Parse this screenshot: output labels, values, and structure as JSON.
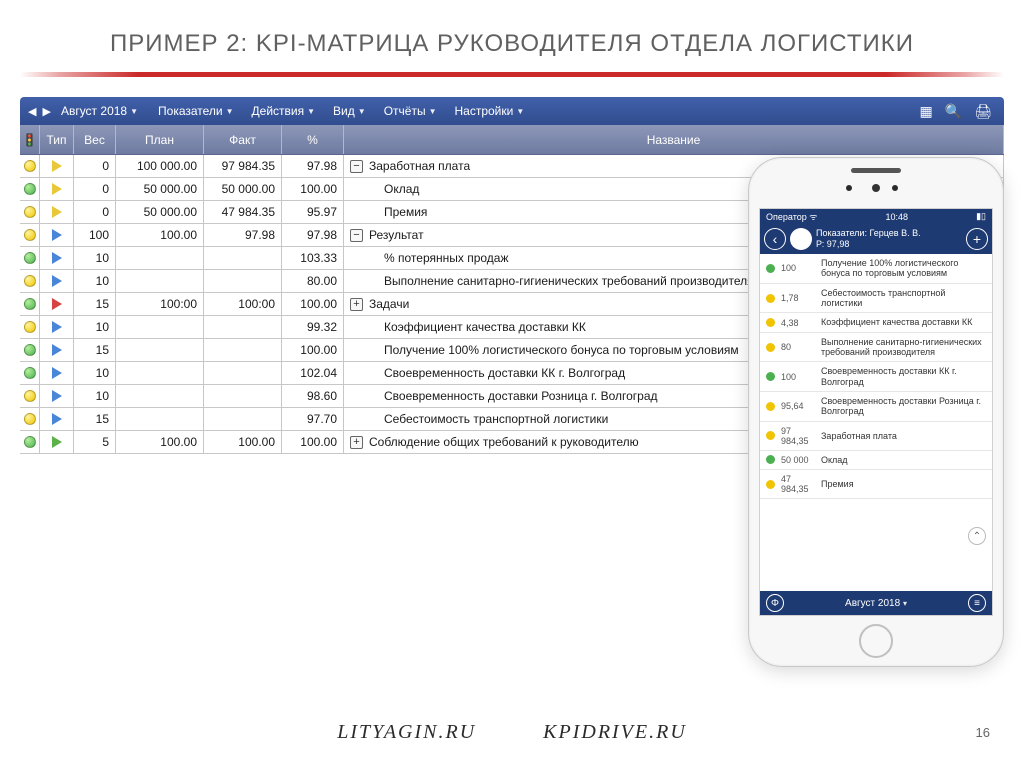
{
  "slide_title": "ПРИМЕР 2:  KPI-МАТРИЦА РУКОВОДИТЕЛЯ ОТДЕЛА ЛОГИСТИКИ",
  "toolbar": {
    "date": "Август 2018",
    "menus": [
      "Показатели",
      "Действия",
      "Вид",
      "Отчёты",
      "Настройки"
    ]
  },
  "columns": {
    "type": "Тип",
    "ves": "Вес",
    "plan": "План",
    "fact": "Факт",
    "pct": "%",
    "name": "Название"
  },
  "rows": [
    {
      "light": "yellow",
      "tri": "yellow",
      "ves": "0",
      "plan": "100 000.00",
      "fact": "97 984.35",
      "pct": "97.98",
      "name": "Заработная плата",
      "exp": "minus",
      "indent": 0
    },
    {
      "light": "green",
      "tri": "yellow",
      "ves": "0",
      "plan": "50 000.00",
      "fact": "50 000.00",
      "pct": "100.00",
      "name": "Оклад",
      "indent": 1
    },
    {
      "light": "yellow",
      "tri": "yellow",
      "ves": "0",
      "plan": "50 000.00",
      "fact": "47 984.35",
      "pct": "95.97",
      "name": "Премия",
      "indent": 1
    },
    {
      "light": "yellow",
      "tri": "blue",
      "ves": "100",
      "plan": "100.00",
      "fact": "97.98",
      "pct": "97.98",
      "name": "Результат",
      "exp": "minus",
      "indent": 0
    },
    {
      "light": "green",
      "tri": "blue",
      "ves": "10",
      "plan": "",
      "fact": "",
      "pct": "103.33",
      "name": "% потерянных продаж",
      "indent": 1
    },
    {
      "light": "yellow",
      "tri": "blue",
      "ves": "10",
      "plan": "",
      "fact": "",
      "pct": "80.00",
      "name": "Выполнение санитарно-гигиенических требований производителя",
      "indent": 1
    },
    {
      "light": "green",
      "tri": "red",
      "ves": "15",
      "plan": "100:00",
      "fact": "100:00",
      "pct": "100.00",
      "name": "Задачи",
      "exp": "plus",
      "indent": 0
    },
    {
      "light": "yellow",
      "tri": "blue",
      "ves": "10",
      "plan": "",
      "fact": "",
      "pct": "99.32",
      "name": "Коэффициент качества доставки КК",
      "indent": 1
    },
    {
      "light": "green",
      "tri": "blue",
      "ves": "15",
      "plan": "",
      "fact": "",
      "pct": "100.00",
      "name": "Получение 100% логистического бонуса по торговым условиям",
      "indent": 1
    },
    {
      "light": "green",
      "tri": "blue",
      "ves": "10",
      "plan": "",
      "fact": "",
      "pct": "102.04",
      "name": "Своевременность доставки КК г. Волгоград",
      "indent": 1
    },
    {
      "light": "yellow",
      "tri": "blue",
      "ves": "10",
      "plan": "",
      "fact": "",
      "pct": "98.60",
      "name": "Своевременность доставки Розница г. Волгоград",
      "indent": 1
    },
    {
      "light": "yellow",
      "tri": "blue",
      "ves": "15",
      "plan": "",
      "fact": "",
      "pct": "97.70",
      "name": "Себестоимость транспортной логистики",
      "indent": 1
    },
    {
      "light": "green",
      "tri": "green",
      "ves": "5",
      "plan": "100.00",
      "fact": "100.00",
      "pct": "100.00",
      "name": "Соблюдение общих требований к руководителю",
      "exp": "plus",
      "indent": 0
    }
  ],
  "phone": {
    "status_left": "Оператор",
    "status_time": "10:48",
    "header_line1": "Показатели: Герцев В. В.",
    "header_line2": "Р: 97,98",
    "items": [
      {
        "dot": "g",
        "val": "100",
        "txt": "Получение 100% логистического бонуса по торговым условиям"
      },
      {
        "dot": "y",
        "val": "1,78",
        "txt": "Себестоимость транспортной логистики"
      },
      {
        "dot": "y",
        "val": "4,38",
        "txt": "Коэффициент качества доставки КК"
      },
      {
        "dot": "y",
        "val": "80",
        "txt": "Выполнение санитарно-гигиенических требований производителя"
      },
      {
        "dot": "g",
        "val": "100",
        "txt": "Своевременность доставки КК г. Волгоград"
      },
      {
        "dot": "y",
        "val": "95,64",
        "txt": "Своевременность доставки Розница г. Волгоград"
      },
      {
        "dot": "y",
        "val": "97 984,35",
        "txt": "Заработная плата"
      },
      {
        "dot": "g",
        "val": "50 000",
        "txt": "Оклад"
      },
      {
        "dot": "y",
        "val": "47 984,35",
        "txt": "Премия"
      }
    ],
    "footer_date": "Август 2018"
  },
  "footer": {
    "left": "LITYAGIN.RU",
    "right": "KPIDRIVE.RU"
  },
  "page_number": "16"
}
